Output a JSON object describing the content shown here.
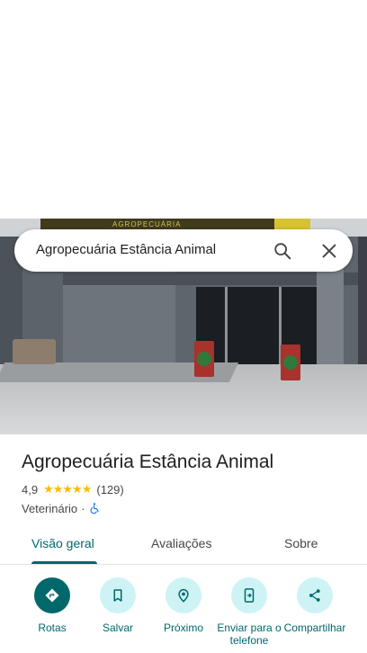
{
  "search": {
    "query": "Agropecuária Estância Animal",
    "search_icon": "search-icon",
    "close_icon": "close-icon"
  },
  "photo": {
    "sign_text": "AGROPECUÁRIA"
  },
  "place": {
    "name": "Agropecuária Estância Animal",
    "rating": "4,9",
    "stars": "★★★★★",
    "review_count": "(129)",
    "category": "Veterinário",
    "separator": "·",
    "accessibility_icon": "wheelchair-icon"
  },
  "tabs": [
    {
      "label": "Visão geral",
      "active": true
    },
    {
      "label": "Avaliações",
      "active": false
    },
    {
      "label": "Sobre",
      "active": false
    }
  ],
  "actions": [
    {
      "label": "Rotas",
      "icon": "directions-icon"
    },
    {
      "label": "Salvar",
      "icon": "bookmark-icon"
    },
    {
      "label": "Próximo",
      "icon": "nearby-icon"
    },
    {
      "label": "Enviar para o telefone",
      "icon": "send-to-phone-icon"
    },
    {
      "label": "Compartilhar",
      "icon": "share-icon"
    }
  ],
  "colors": {
    "accent": "#00686b",
    "accent_light": "#cdf3f5",
    "star": "#fbbc04"
  }
}
